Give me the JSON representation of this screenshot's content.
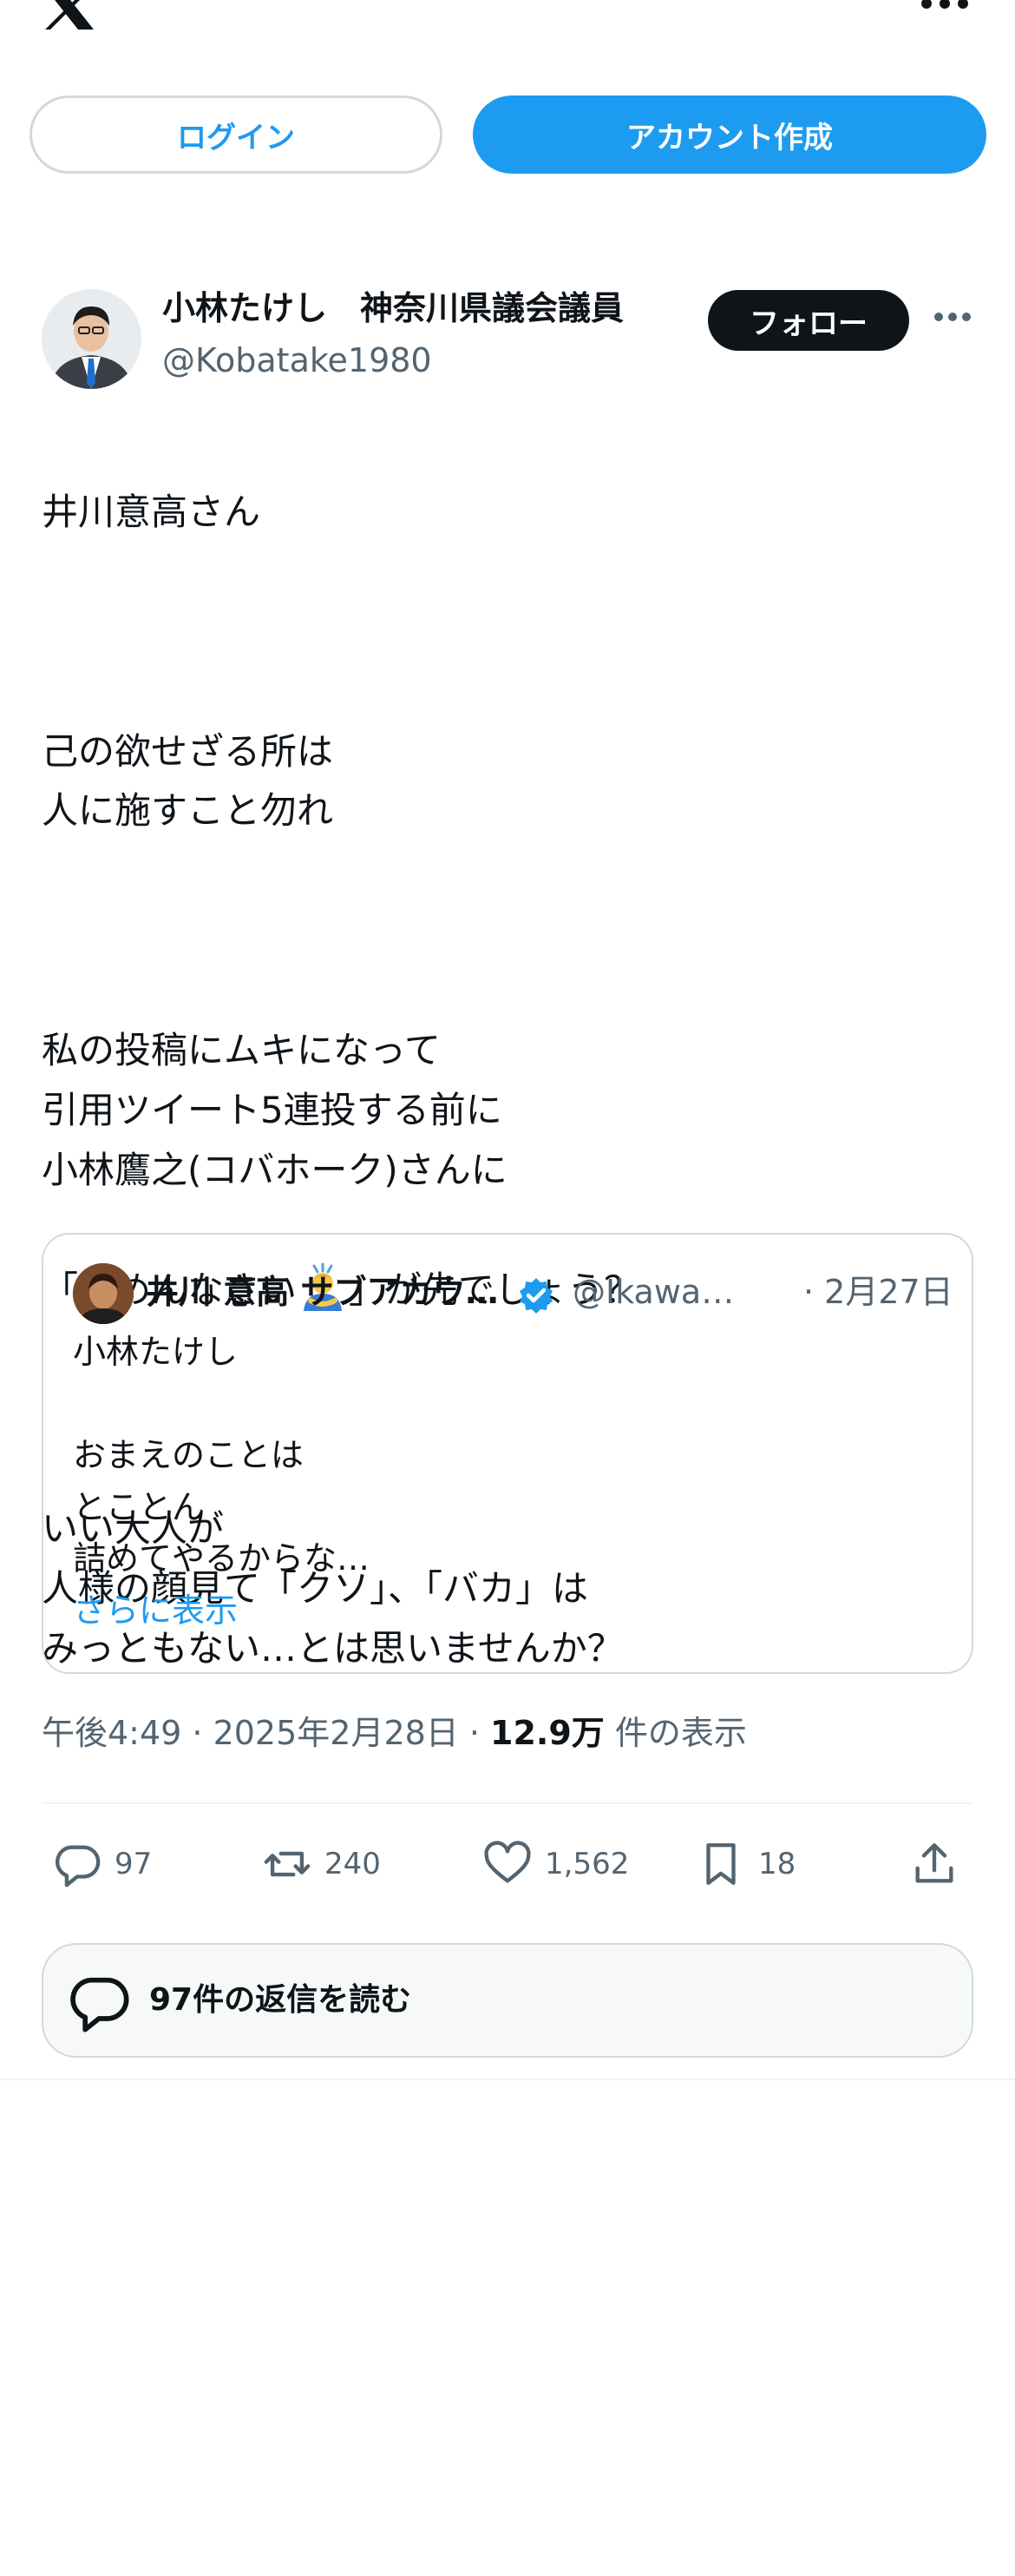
{
  "header": {
    "logo_icon": "x-logo-icon",
    "more_icon": "more-horizontal-icon"
  },
  "auth": {
    "login_label": "ログイン",
    "signup_label": "アカウント作成"
  },
  "post": {
    "author_name": "小林たけし　神奈川県議会議員",
    "author_handle": "@Kobatake1980",
    "follow_label": "フォロー",
    "paragraphs": [
      "井川意高さん",
      "己の欲せざる所は\n人に施すこと勿れ",
      "私の投稿にムキになって\n引用ツイート5連投する前に\n小林鷹之(コバホーク)さんに",
      "いい大人が\n人様の顔見て「クソ」、「バカ」は\nみっともない…とは思いませんか？"
    ],
    "apology_before": "「ごめんなさい",
    "apology_emoji": "person-bowing-emoji",
    "apology_after": "」が先でしょう？"
  },
  "quote": {
    "author_name": "井川 意高 サブアカウント",
    "verified_icon": "verified-badge-icon",
    "handle": "@Ikawa…",
    "date": "· 2月27日",
    "text": "小林たけし\n\nおまえのことは\nとことん\n詰めてやるからな…",
    "show_more": "さらに表示"
  },
  "meta": {
    "time": "午後4:49 · 2025年2月28日 · ",
    "views": "12.9万",
    "views_suffix": " 件の表示"
  },
  "actions": {
    "replies": "97",
    "reposts": "240",
    "likes": "1,562",
    "bookmarks": "18"
  },
  "read_replies": {
    "label": "97件の返信を読む"
  },
  "colors": {
    "accent": "#1d9bf0",
    "text": "#0f1419",
    "muted": "#536471",
    "border": "#cfd9de"
  }
}
